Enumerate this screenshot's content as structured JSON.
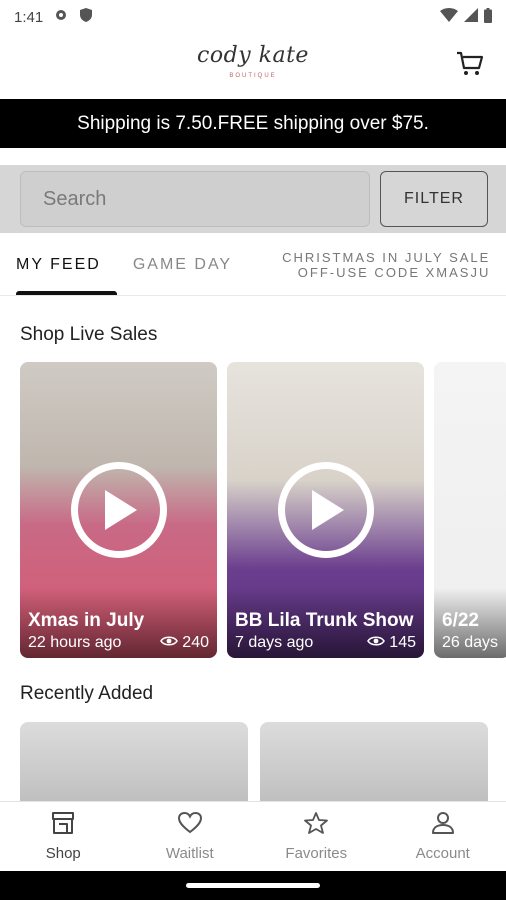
{
  "status_bar": {
    "time": "1:41"
  },
  "header": {
    "logo_text": "cody kate",
    "logo_subtext": "BOUTIQUE"
  },
  "banner": {
    "text": "Shipping is 7.50.FREE shipping over $75."
  },
  "search": {
    "placeholder": "Search",
    "filter_label": "FILTER"
  },
  "tabs": {
    "my_feed": "MY FEED",
    "game_day": "GAME DAY",
    "christmas_line1": "CHRISTMAS IN JULY SALE",
    "christmas_line2": "OFF-USE CODE XMASJU"
  },
  "live_sales": {
    "title": "Shop Live Sales",
    "items": [
      {
        "title": "Xmas in July",
        "time": "22 hours ago",
        "views": "240"
      },
      {
        "title": "BB Lila Trunk Show",
        "time": "7 days ago",
        "views": "145"
      },
      {
        "title": "6/22",
        "time": "26 days"
      }
    ]
  },
  "recently_added": {
    "title": "Recently Added"
  },
  "bottom_nav": {
    "shop": "Shop",
    "waitlist": "Waitlist",
    "favorites": "Favorites",
    "account": "Account"
  },
  "colors": {
    "banner_bg": "#000000",
    "accent": "#111111",
    "inactive": "#8a8a8a"
  }
}
